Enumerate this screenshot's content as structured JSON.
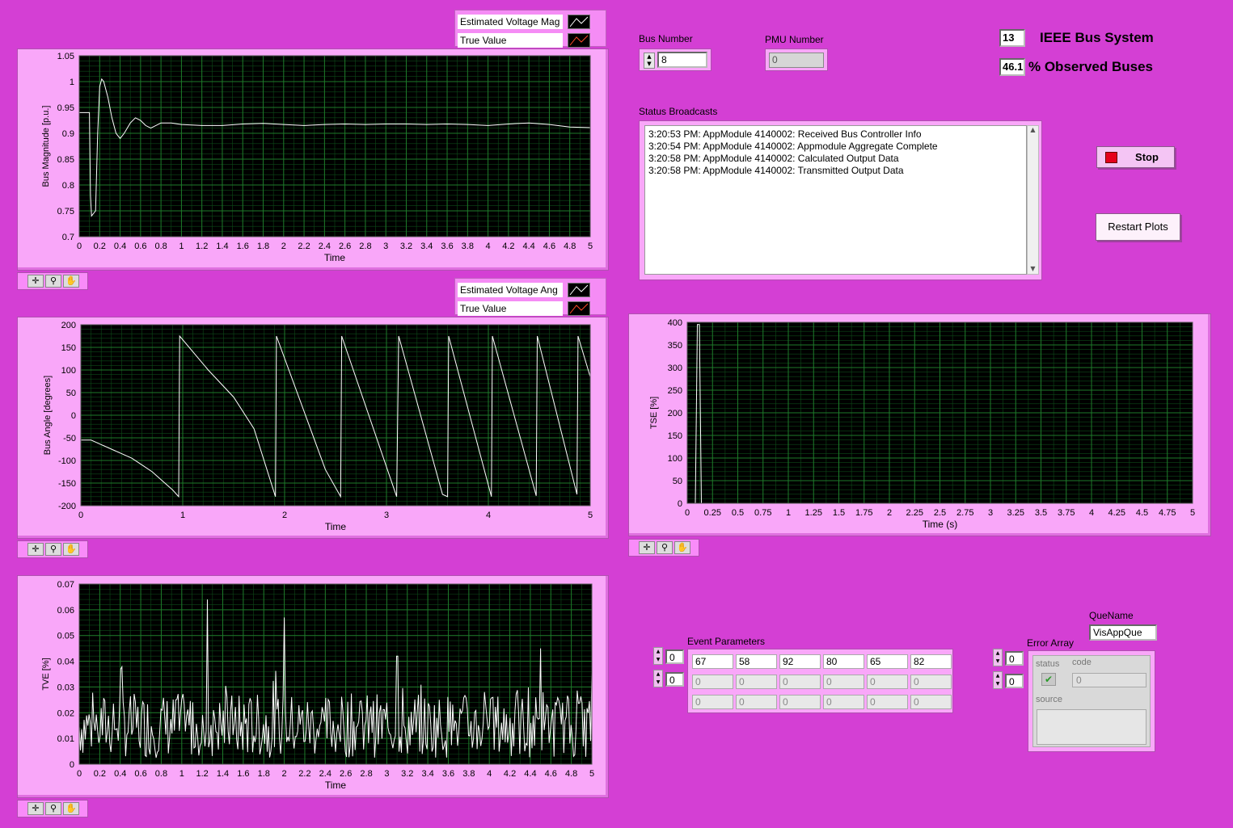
{
  "legend_mag": {
    "estimated": "Estimated Voltage Mag",
    "true_value": "True Value"
  },
  "legend_ang": {
    "estimated": "Estimated Voltage Ang",
    "true_value": "True Value"
  },
  "bus_number": {
    "label": "Bus Number",
    "value": "8"
  },
  "pmu_number": {
    "label": "PMU Number",
    "value": "0"
  },
  "ieee": {
    "value": "13",
    "label": "IEEE Bus System"
  },
  "observed": {
    "value": "46.1",
    "label": "% Observed Buses"
  },
  "status": {
    "label": "Status Broadcasts",
    "lines": [
      "3:20:53 PM: AppModule 4140002: Received Bus Controller Info",
      "3:20:54 PM: AppModule 4140002: Appmodule Aggregate Complete",
      "3:20:58 PM: AppModule 4140002: Calculated Output Data",
      "3:20:58 PM: AppModule 4140002: Transmitted Output Data"
    ]
  },
  "buttons": {
    "stop": "Stop",
    "restart": "Restart Plots"
  },
  "event_params": {
    "label": "Event Parameters",
    "index": [
      "0",
      "0"
    ],
    "rows": [
      [
        "67",
        "58",
        "92",
        "80",
        "65",
        "82"
      ],
      [
        "0",
        "0",
        "0",
        "0",
        "0",
        "0"
      ],
      [
        "0",
        "0",
        "0",
        "0",
        "0",
        "0"
      ]
    ]
  },
  "quename": {
    "label": "QueName",
    "value": "VisAppQue"
  },
  "error_array": {
    "label": "Error Array",
    "index": [
      "0",
      "0"
    ],
    "status_label": "status",
    "code_label": "code",
    "code_value": "0",
    "source_label": "source"
  },
  "colors": {
    "plot_bg": "#000000",
    "grid": "#1e7a2a",
    "trace": "#ffffff",
    "panel": "#f9a7f9",
    "background": "#d43fd4"
  },
  "icons": [
    "crosshair-icon",
    "zoom-icon",
    "hand-icon"
  ],
  "chart_data": [
    {
      "type": "line",
      "xlabel": "Time",
      "ylabel": "Bus Magnitude [p.u.]",
      "xlim": [
        0,
        5
      ],
      "ylim": [
        0.7,
        1.05
      ],
      "xticks": [
        "0",
        "0.2",
        "0.4",
        "0.6",
        "0.8",
        "1",
        "1.2",
        "1.4",
        "1.6",
        "1.8",
        "2",
        "2.2",
        "2.4",
        "2.6",
        "2.8",
        "3",
        "3.2",
        "3.4",
        "3.6",
        "3.8",
        "4",
        "4.2",
        "4.4",
        "4.6",
        "4.8",
        "5"
      ],
      "yticks": [
        "0.7",
        "0.75",
        "0.8",
        "0.85",
        "0.9",
        "0.95",
        "1",
        "1.05"
      ],
      "series": [
        {
          "name": "Estimated Voltage Mag",
          "x": [
            0,
            0.1,
            0.11,
            0.12,
            0.16,
            0.18,
            0.2,
            0.22,
            0.24,
            0.28,
            0.32,
            0.36,
            0.4,
            0.44,
            0.5,
            0.55,
            0.6,
            0.65,
            0.7,
            0.8,
            0.9,
            1.0,
            1.2,
            1.4,
            1.6,
            1.8,
            2.0,
            2.2,
            2.4,
            2.6,
            2.8,
            3.0,
            3.2,
            3.4,
            3.6,
            3.8,
            4.0,
            4.2,
            4.4,
            4.6,
            4.8,
            5.0
          ],
          "y": [
            0.94,
            0.94,
            0.78,
            0.74,
            0.75,
            0.9,
            0.99,
            1.005,
            1.0,
            0.97,
            0.93,
            0.9,
            0.89,
            0.9,
            0.92,
            0.93,
            0.925,
            0.915,
            0.91,
            0.92,
            0.92,
            0.917,
            0.915,
            0.915,
            0.918,
            0.919,
            0.917,
            0.915,
            0.917,
            0.918,
            0.917,
            0.918,
            0.918,
            0.917,
            0.918,
            0.917,
            0.915,
            0.918,
            0.92,
            0.917,
            0.912,
            0.911
          ]
        }
      ]
    },
    {
      "type": "line",
      "xlabel": "Time",
      "ylabel": "Bus Angle [degrees]",
      "xlim": [
        0,
        5
      ],
      "ylim": [
        -200,
        200
      ],
      "xticks": [
        "0",
        "1",
        "2",
        "3",
        "4",
        "5"
      ],
      "yticks": [
        "-200",
        "-150",
        "-100",
        "-50",
        "0",
        "50",
        "100",
        "150",
        "200"
      ],
      "series": [
        {
          "name": "Estimated Voltage Ang",
          "x": [
            0,
            0.1,
            0.15,
            0.2,
            0.3,
            0.4,
            0.5,
            0.6,
            0.7,
            0.8,
            0.9,
            0.96,
            0.97,
            1.25,
            1.5,
            1.7,
            1.91,
            1.92,
            2.4,
            2.55,
            2.56,
            3.1,
            3.12,
            3.55,
            3.6,
            3.61,
            4.03,
            4.04,
            4.47,
            4.48,
            4.87,
            4.88,
            5.0
          ],
          "y": [
            -55,
            -55,
            -60,
            -65,
            -75,
            -85,
            -95,
            -110,
            -125,
            -145,
            -165,
            -180,
            175,
            100,
            40,
            -30,
            -180,
            175,
            -120,
            -180,
            175,
            -180,
            175,
            -175,
            -180,
            175,
            -180,
            175,
            -178,
            175,
            -175,
            175,
            85
          ]
        }
      ]
    },
    {
      "type": "line",
      "xlabel": "Time (s)",
      "ylabel": "TSE [%]",
      "xlim": [
        0,
        5
      ],
      "ylim": [
        0,
        400
      ],
      "xticks": [
        "0",
        "0.25",
        "0.5",
        "0.75",
        "1",
        "1.25",
        "1.5",
        "1.75",
        "2",
        "2.25",
        "2.5",
        "2.75",
        "3",
        "3.25",
        "3.5",
        "3.75",
        "4",
        "4.25",
        "4.5",
        "4.75",
        "5"
      ],
      "yticks": [
        "0",
        "50",
        "100",
        "150",
        "200",
        "250",
        "300",
        "350",
        "400"
      ],
      "series": [
        {
          "name": "TSE",
          "x": [
            0,
            0.08,
            0.1,
            0.12,
            0.14,
            5.0
          ],
          "y": [
            0,
            0,
            395,
            395,
            0,
            0
          ]
        }
      ]
    },
    {
      "type": "line",
      "xlabel": "Time",
      "ylabel": "TVE [%]",
      "xlim": [
        0,
        5
      ],
      "ylim": [
        0,
        0.07
      ],
      "xticks": [
        "0",
        "0.2",
        "0.4",
        "0.6",
        "0.8",
        "1",
        "1.2",
        "1.4",
        "1.6",
        "1.8",
        "2",
        "2.2",
        "2.4",
        "2.6",
        "2.8",
        "3",
        "3.2",
        "3.4",
        "3.6",
        "3.8",
        "4",
        "4.2",
        "4.4",
        "4.6",
        "4.8",
        "5"
      ],
      "yticks": [
        "0",
        "0.01",
        "0.02",
        "0.03",
        "0.04",
        "0.05",
        "0.06",
        "0.07"
      ],
      "series": [
        {
          "name": "TVE",
          "noise": true,
          "mean": 0.015,
          "spikes": [
            [
              1.25,
              0.064
            ],
            [
              2.0,
              0.057
            ],
            [
              0.4,
              0.037
            ],
            [
              3.1,
              0.042
            ],
            [
              4.5,
              0.045
            ]
          ]
        }
      ]
    }
  ]
}
